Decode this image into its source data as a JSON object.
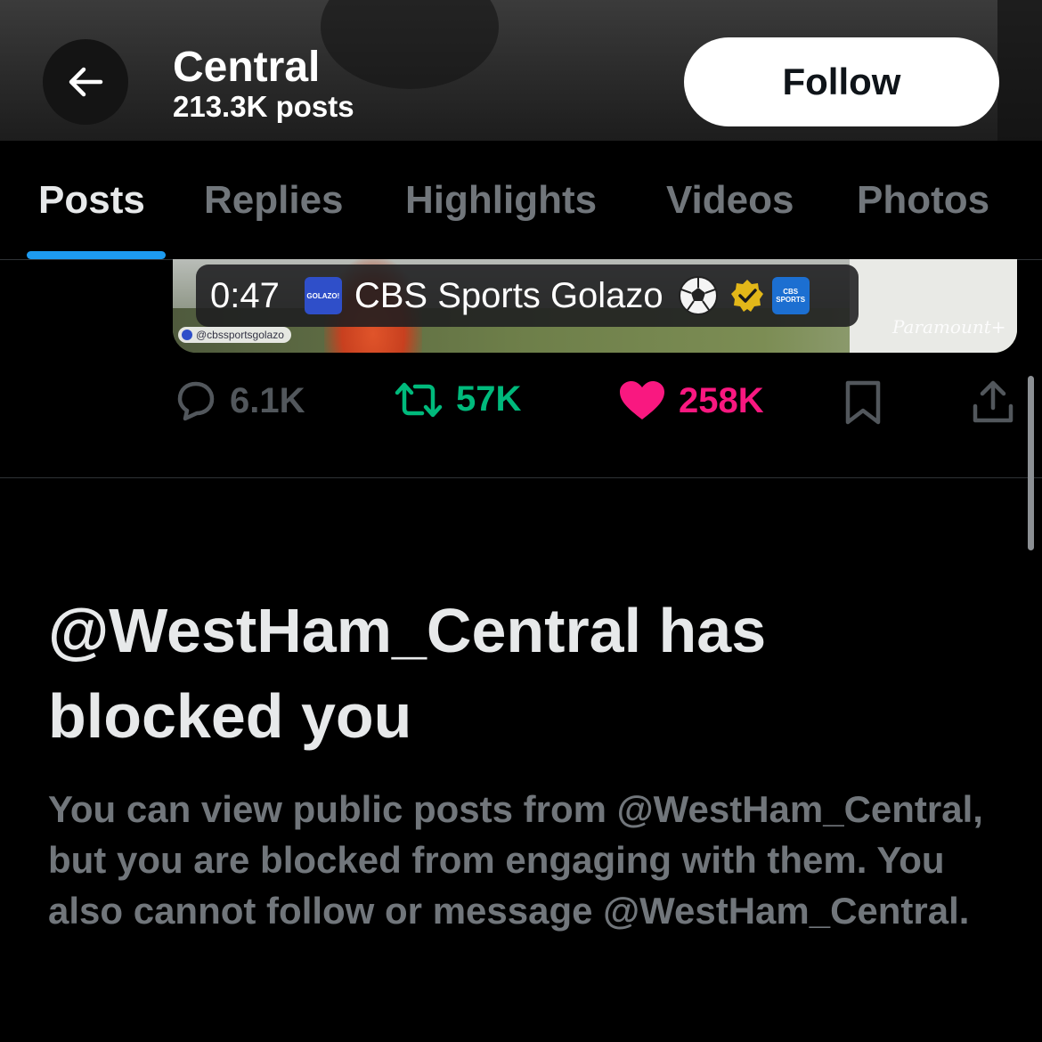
{
  "header": {
    "title": "Central",
    "post_count": "213.3K posts",
    "follow_label": "Follow"
  },
  "tabs": [
    {
      "label": "Posts",
      "active": true
    },
    {
      "label": "Replies",
      "active": false
    },
    {
      "label": "Highlights",
      "active": false
    },
    {
      "label": "Videos",
      "active": false
    },
    {
      "label": "Photos",
      "active": false
    }
  ],
  "video": {
    "duration": "0:47",
    "channel_name": "CBS Sports Golazo",
    "golazo_logo_text": "GOLAZO!",
    "cbs_logo_text": "CBS SPORTS",
    "watermark": "@cbssportsgolazo",
    "paramount_watermark": "Paramount+"
  },
  "actions": {
    "replies": "6.1K",
    "reposts": "57K",
    "likes": "258K"
  },
  "blocked": {
    "title": "@WestHam_Central has blocked you",
    "body": "You can view public posts from @WestHam_Central, but you are blocked from engaging with them. You also cannot follow or message @WestHam_Central."
  },
  "colors": {
    "accent": "#1d9bf0",
    "repost": "#00ba7c",
    "like": "#f91880",
    "muted": "#71767b"
  }
}
